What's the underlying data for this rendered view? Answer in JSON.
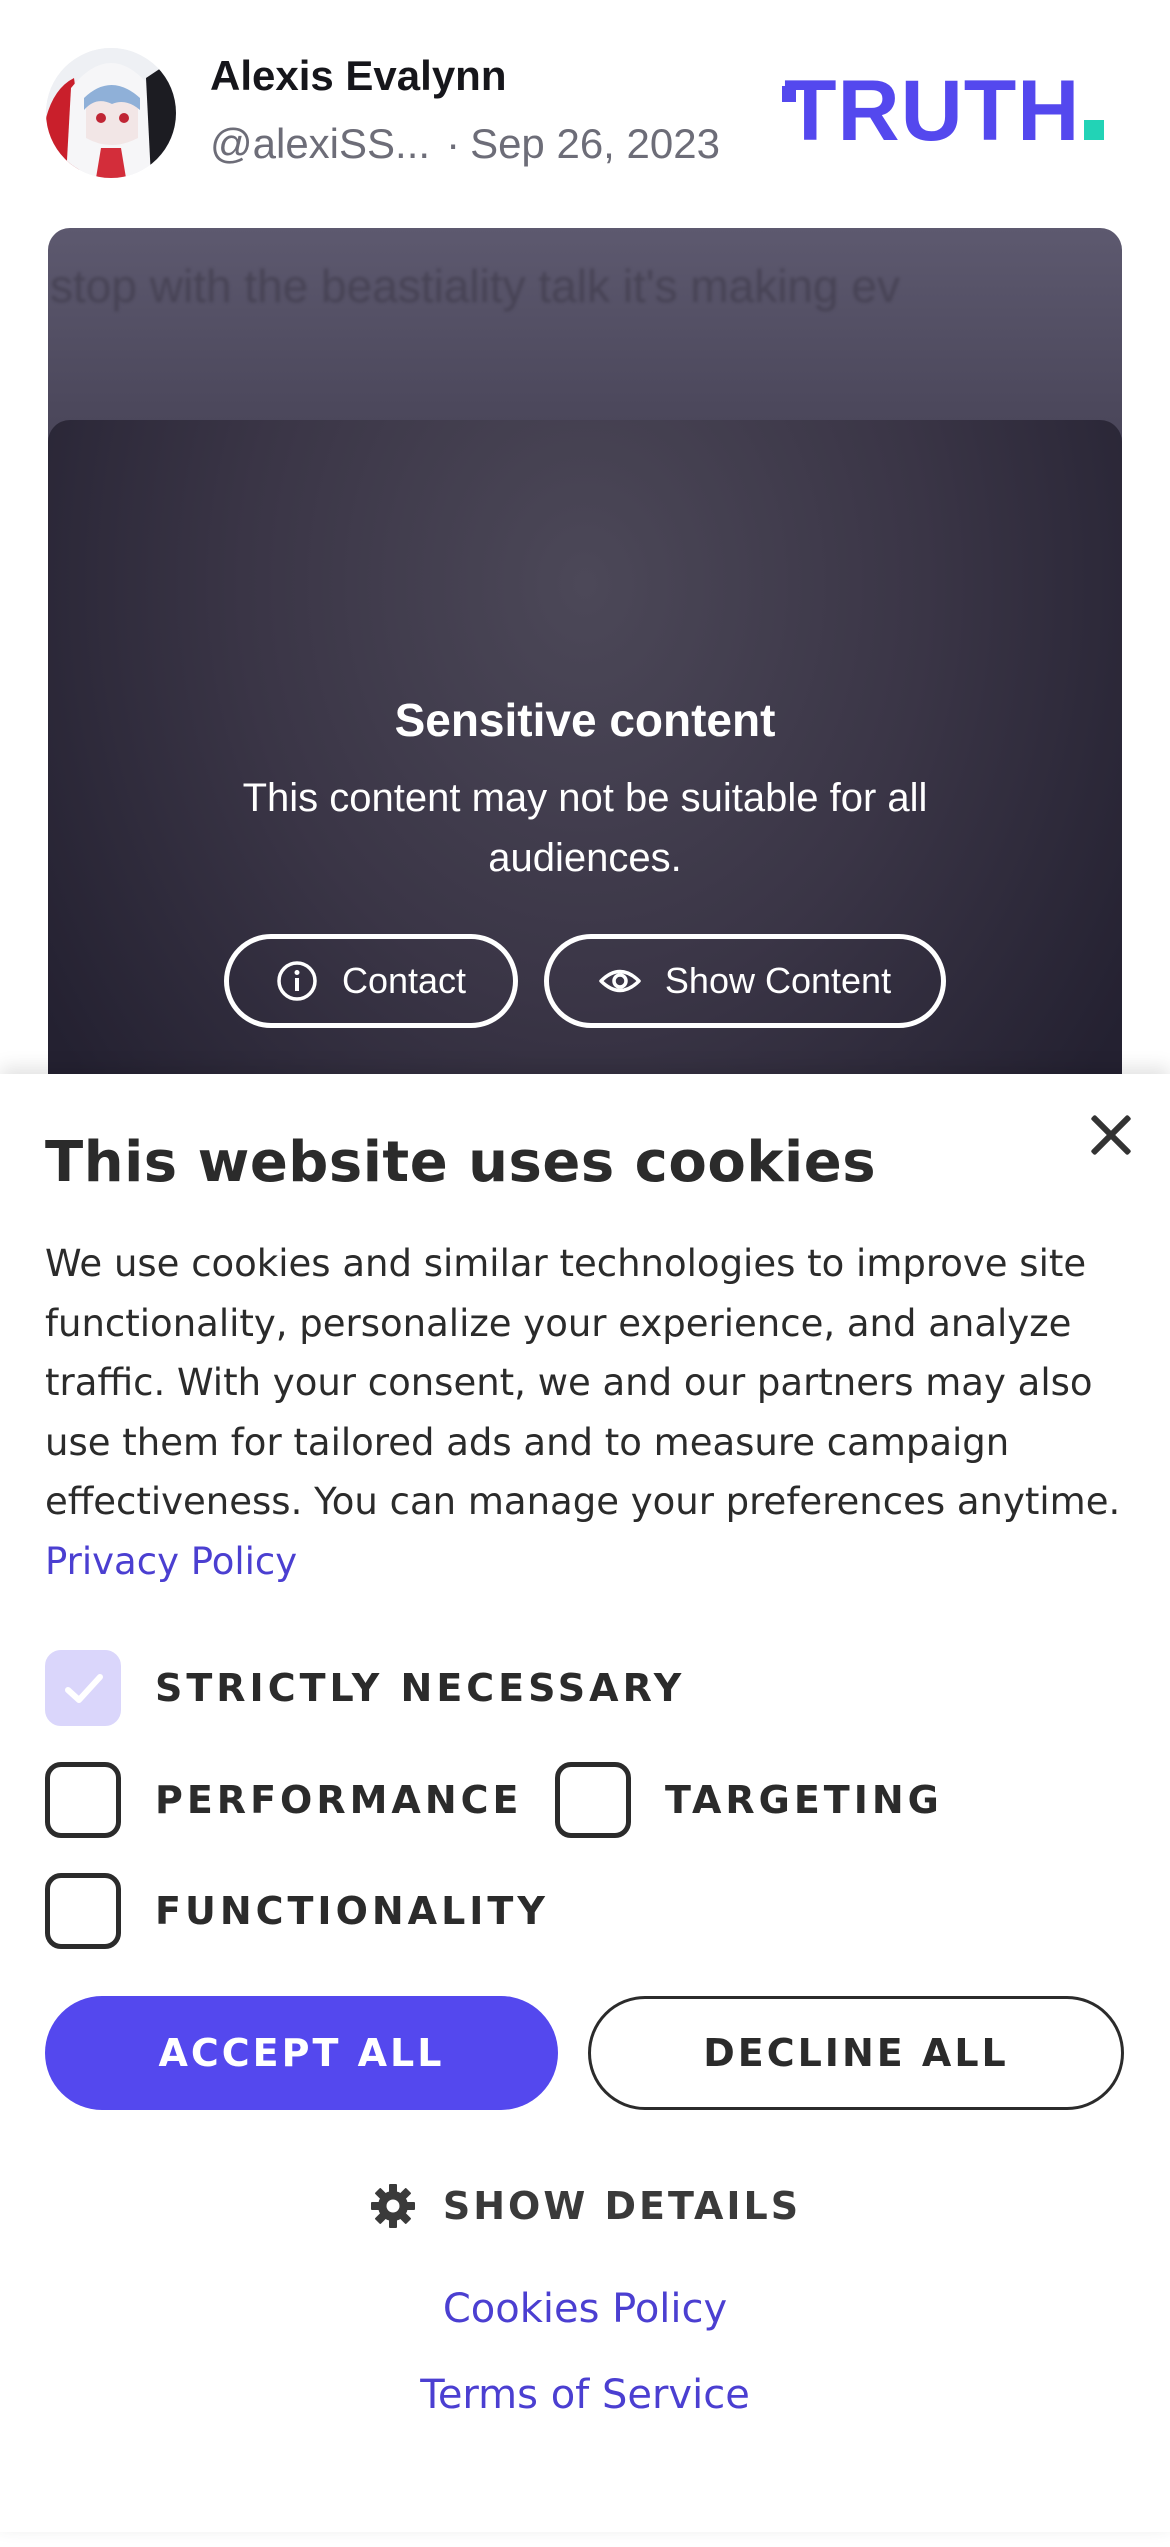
{
  "post": {
    "author_name": "Alexis Evalynn",
    "handle": "@alexiSS...",
    "separator": "·",
    "date": "Sep 26, 2023",
    "logo_text": "TRUTH",
    "text": "stop with the beastiality talk it's making ev",
    "sensitive": {
      "title": "Sensitive content",
      "description": "This content may not be suitable for all audiences.",
      "contact_label": "Contact",
      "show_label": "Show Content"
    }
  },
  "cookies": {
    "title": "This website uses cookies",
    "body": "We use cookies and similar technologies to improve site functionality, personalize your experience, and analyze traffic. With your consent, we and our partners may also use them for tailored ads and to measure campaign effectiveness. You can manage your preferences anytime.",
    "privacy_link": "Privacy Policy",
    "categories": {
      "strictly_necessary": "STRICTLY NECESSARY",
      "performance": "PERFORMANCE",
      "targeting": "TARGETING",
      "functionality": "FUNCTIONALITY"
    },
    "accept_label": "ACCEPT ALL",
    "decline_label": "DECLINE ALL",
    "details_label": "SHOW DETAILS",
    "cookies_policy_link": "Cookies Policy",
    "terms_link": "Terms of Service"
  },
  "colors": {
    "brand": "#5448ee",
    "brand_accent": "#22d3b6",
    "link": "#4b3fd1",
    "checked_fill": "#dad6fb"
  },
  "icons": {
    "contact": "info-icon",
    "show": "eye-icon",
    "details": "gear-icon",
    "close": "close-icon",
    "check": "checkmark-icon"
  }
}
